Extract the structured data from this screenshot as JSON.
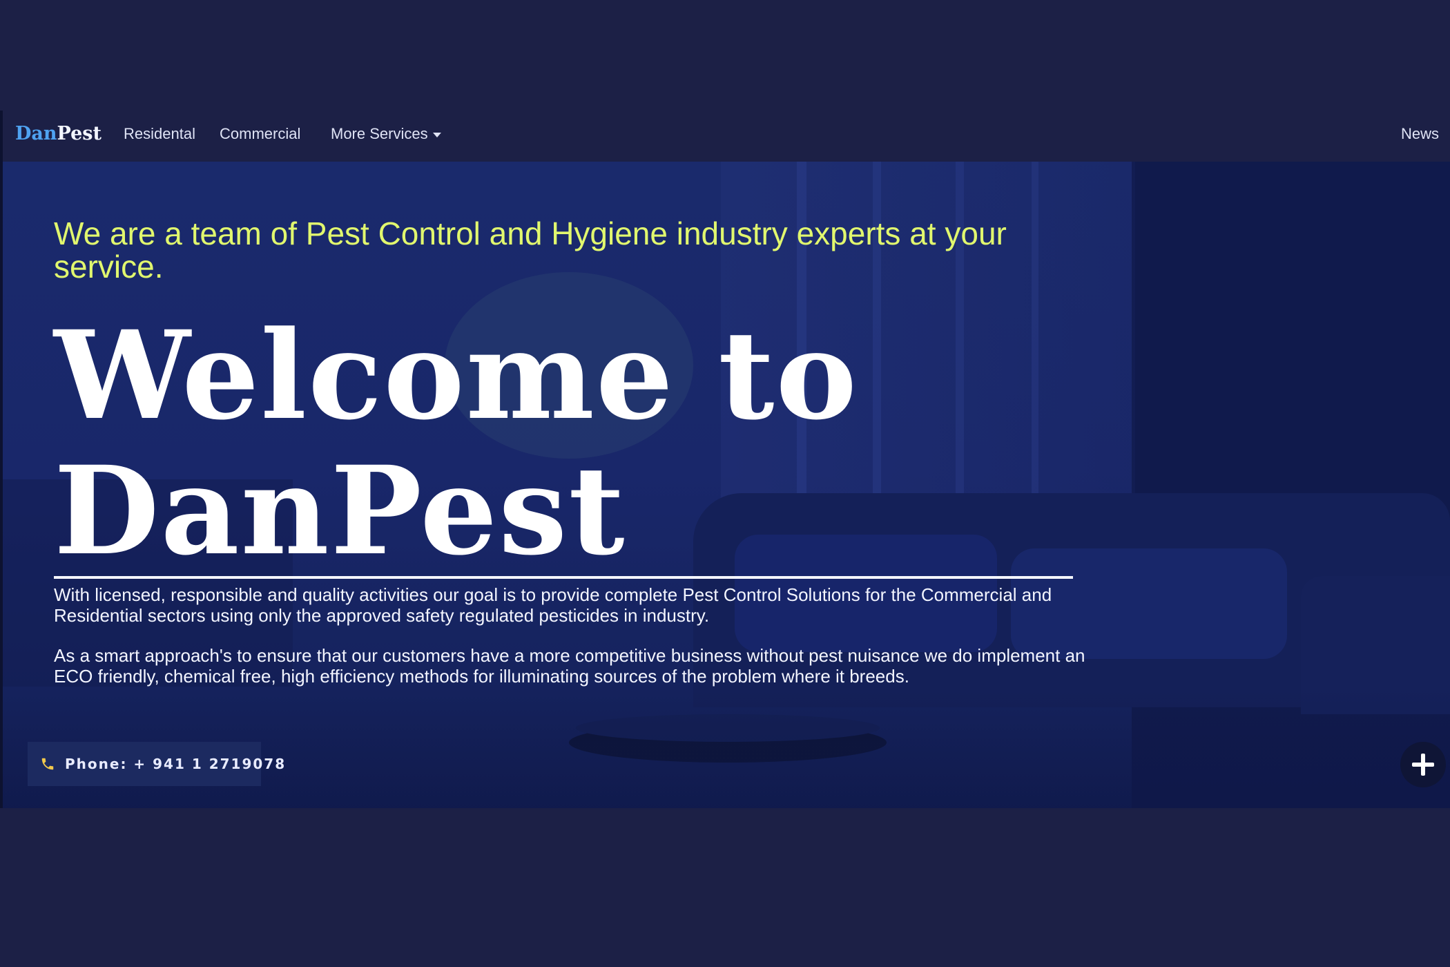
{
  "navbar": {
    "brand": {
      "part1": "Dan",
      "part2": "Pest"
    },
    "items": [
      {
        "label": "Residental"
      },
      {
        "label": "Commercial"
      },
      {
        "label": "More Services"
      },
      {
        "label": "News"
      }
    ]
  },
  "hero": {
    "tagline": "We are a team of Pest Control and Hygiene industry experts at your service.",
    "title": "Welcome to DanPest",
    "paragraph1": "With licensed, responsible and quality activities our goal is to provide complete Pest Control Solutions for the Commercial and Residential sectors using only the approved safety regulated pesticides in industry.",
    "paragraph2": "As a smart approach's to ensure that our customers have a more competitive business without pest nuisance we do implement an ECO friendly, chemical free, high efficiency methods for illuminating sources of the problem where it breeds.",
    "phone_label": "Phone: + 941 1 2719078"
  },
  "icons": {
    "phone": "phone-icon",
    "dropdown": "caret-down-icon",
    "fab": "plus-icon"
  },
  "colors": {
    "page_background": "#1c2046",
    "hero_overlay": "#1a2a6c",
    "brand_accent": "#4fa3f2",
    "tagline": "#e1f76e",
    "text_light": "#f3f5ff"
  }
}
